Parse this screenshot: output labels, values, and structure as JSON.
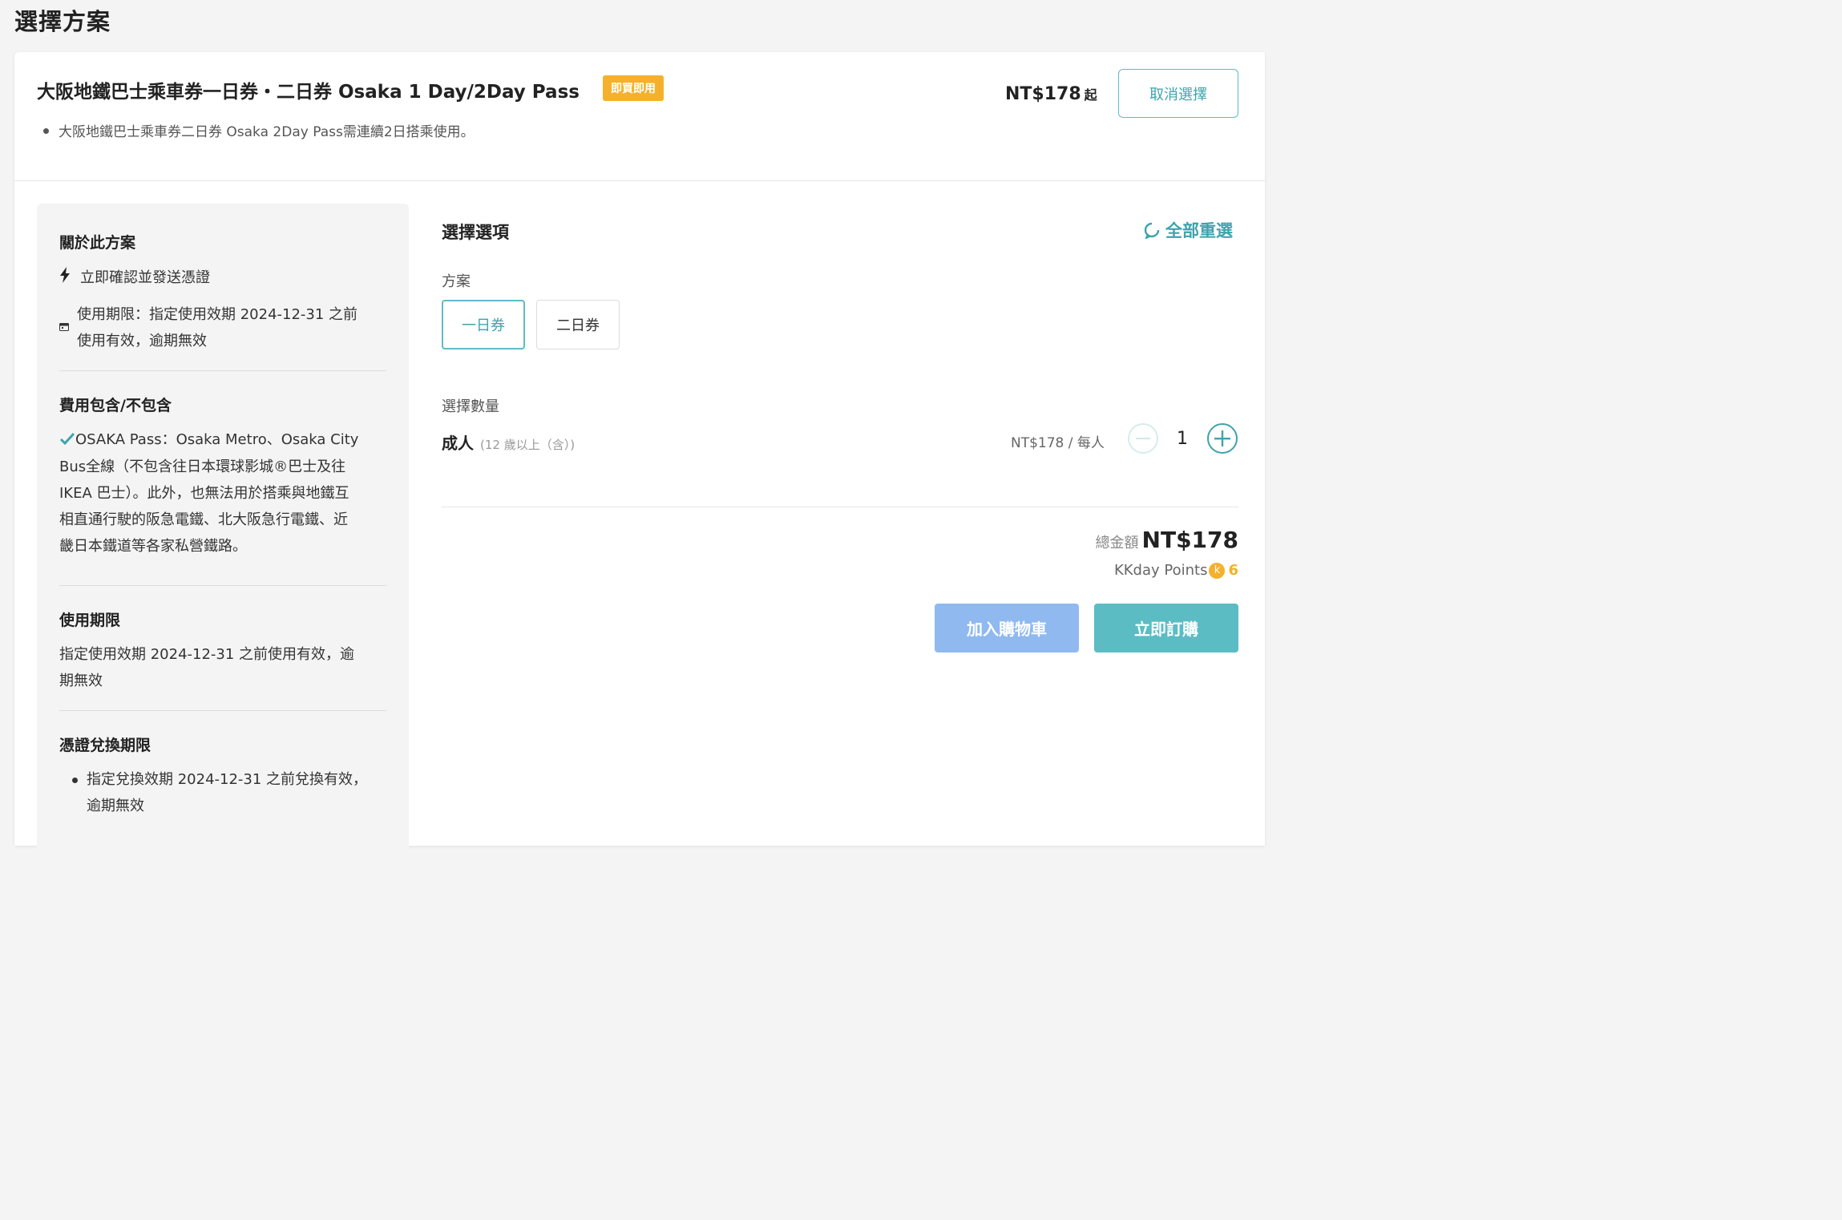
{
  "page": {
    "heading": "選擇方案"
  },
  "plan": {
    "title": "大阪地鐵巴士乘車券一日券・二日券 Osaka 1 Day/2Day Pass",
    "badge": "即買即用",
    "note": "大阪地鐵巴士乘車券二日券 Osaka 2Day Pass需連續2日搭乘使用。",
    "from_price": "NT$178",
    "from_suffix": "起",
    "cancel_label": "取消選擇"
  },
  "about": {
    "title": "關於此方案",
    "instant_confirm": "立即確認並發送憑證",
    "validity_line1": "使用期限：指定使用效期 2024-12-31 之前",
    "validity_line2": "使用有效，逾期無效"
  },
  "inclusions": {
    "title": "費用包含/不包含",
    "lines": [
      "OSAKA Pass：Osaka Metro、Osaka City",
      "Bus全線（不包含往日本環球影城®巴士及往",
      "IKEA 巴士）。此外，也無法用於搭乘與地鐵互",
      "相直通行駛的阪急電鐵、北大阪急行電鐵、近",
      "畿日本鐵道等各家私營鐵路。"
    ]
  },
  "usage_period": {
    "title": "使用期限",
    "line1": "指定使用效期 2024-12-31 之前使用有效，逾",
    "line2": "期無效"
  },
  "redemption": {
    "title": "憑證兌換期限",
    "line1": "指定兌換效期 2024-12-31 之前兌換有效，",
    "line2": "逾期無效"
  },
  "options": {
    "title": "選擇選項",
    "reset_label": "全部重選",
    "plan_label": "方案",
    "plans": [
      "一日券",
      "二日券"
    ],
    "selected_plan": "一日券",
    "quantity_label": "選擇數量",
    "adult_label": "成人",
    "adult_age": "(12 歲以上（含）)",
    "unit_price": "NT$178 / 每人",
    "quantity": "1"
  },
  "summary": {
    "total_label": "總金額",
    "total_amount": "NT$178",
    "points_label": "KKday Points",
    "points_coin": "k",
    "points_value": "6",
    "add_to_cart": "加入購物車",
    "buy_now": "立即訂購"
  },
  "colors": {
    "accent": "#3fa3ad",
    "badge": "#f5b12c",
    "cart_button": "#8fb9ef",
    "buy_button": "#5bbcc4"
  }
}
